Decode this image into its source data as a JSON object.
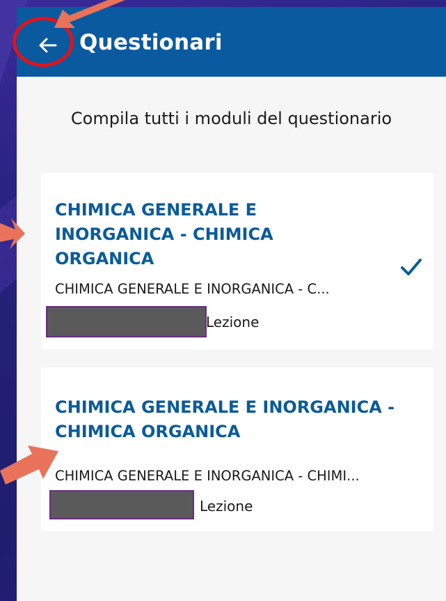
{
  "header": {
    "title": "Questionari",
    "back_icon": "arrow-left-icon"
  },
  "main": {
    "instruction": "Compila tutti i moduli del questionario",
    "cards": [
      {
        "title": "CHIMICA GENERALE E INORGANICA - CHIMICA ORGANICA",
        "description": "CHIMICA GENERALE E INORGANICA - C...",
        "type": "Lezione",
        "completed": true
      },
      {
        "title": "CHIMICA GENERALE E INORGANICA - CHIMICA ORGANICA",
        "description": "CHIMICA GENERALE E INORGANICA - CHIMI...",
        "type": "Lezione",
        "completed": false
      }
    ]
  },
  "colors": {
    "appbar": "#0a5aa0",
    "card_title": "#0b5b98",
    "annotation": "#e2121b",
    "arrow": "#e8735a"
  }
}
